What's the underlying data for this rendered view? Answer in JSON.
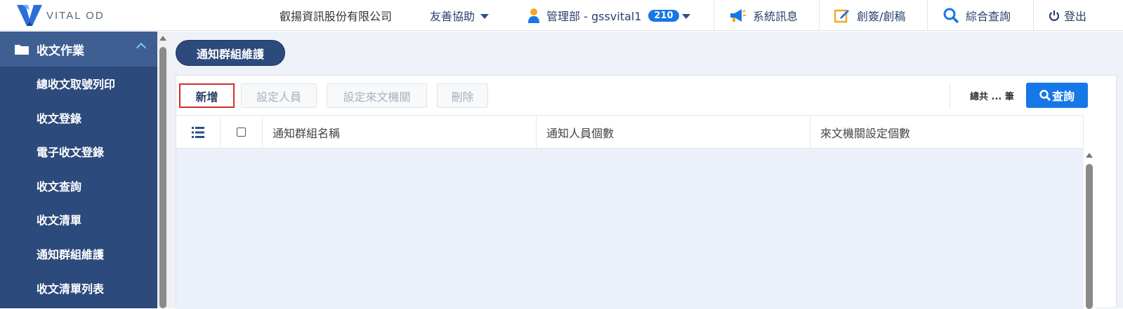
{
  "brand": {
    "logo_text": "VITAL OD"
  },
  "header": {
    "company": "叡揚資訊股份有限公司",
    "accessibility": "友善協助",
    "user": "管理部 - gssvital1",
    "badge_count": "210",
    "messages": "系統訊息",
    "draft": "創簽/創稿",
    "search": "綜合查詢",
    "logout": "登出"
  },
  "sidebar": {
    "section": "收文作業",
    "items": [
      {
        "label": "總收文取號列印"
      },
      {
        "label": "收文登錄"
      },
      {
        "label": "電子收文登錄"
      },
      {
        "label": "收文查詢"
      },
      {
        "label": "收文清單"
      },
      {
        "label": "通知群組維護"
      },
      {
        "label": "收文清單列表"
      }
    ]
  },
  "page": {
    "title": "通知群組維護"
  },
  "toolbar": {
    "add": "新增",
    "set_members": "設定人員",
    "set_agencies": "設定來文機關",
    "delete": "刪除",
    "total": "總共 ... 筆",
    "query": "查詢"
  },
  "table": {
    "columns": [
      "通知群組名稱",
      "通知人員個數",
      "來文機關設定個數"
    ],
    "rows": []
  },
  "colors": {
    "sidebar_bg": "#2c4a7c",
    "sidebar_active": "#3f5f93",
    "accent": "#1677e6",
    "highlight_border": "#d52b2b"
  }
}
